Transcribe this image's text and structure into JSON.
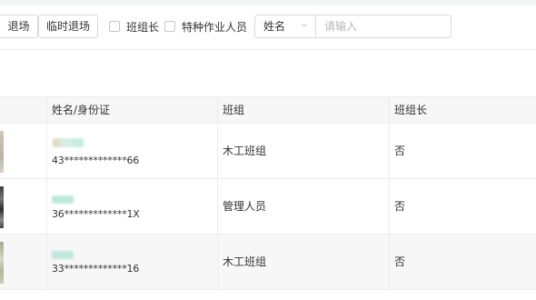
{
  "toolbar": {
    "exit_label": "退场",
    "temp_exit_label": "临时退场",
    "team_leader_checkbox": "班组长",
    "special_worker_checkbox": "特种作业人员",
    "search_field_select": "姓名",
    "search_placeholder": "请输入"
  },
  "table": {
    "columns": [
      "",
      "姓名/身份证",
      "班组",
      "班组长"
    ],
    "rows": [
      {
        "id_number": "43*************66",
        "team": "木工班组",
        "is_leader": "否"
      },
      {
        "id_number": "36*************1X",
        "team": "管理人员",
        "is_leader": "否"
      },
      {
        "id_number": "33*************16",
        "team": "木工班组",
        "is_leader": "否"
      }
    ]
  },
  "colors": {
    "border": "#d9d9d9",
    "header_bg": "#f7f7f7",
    "blurred_name": "#bfe8dc"
  }
}
